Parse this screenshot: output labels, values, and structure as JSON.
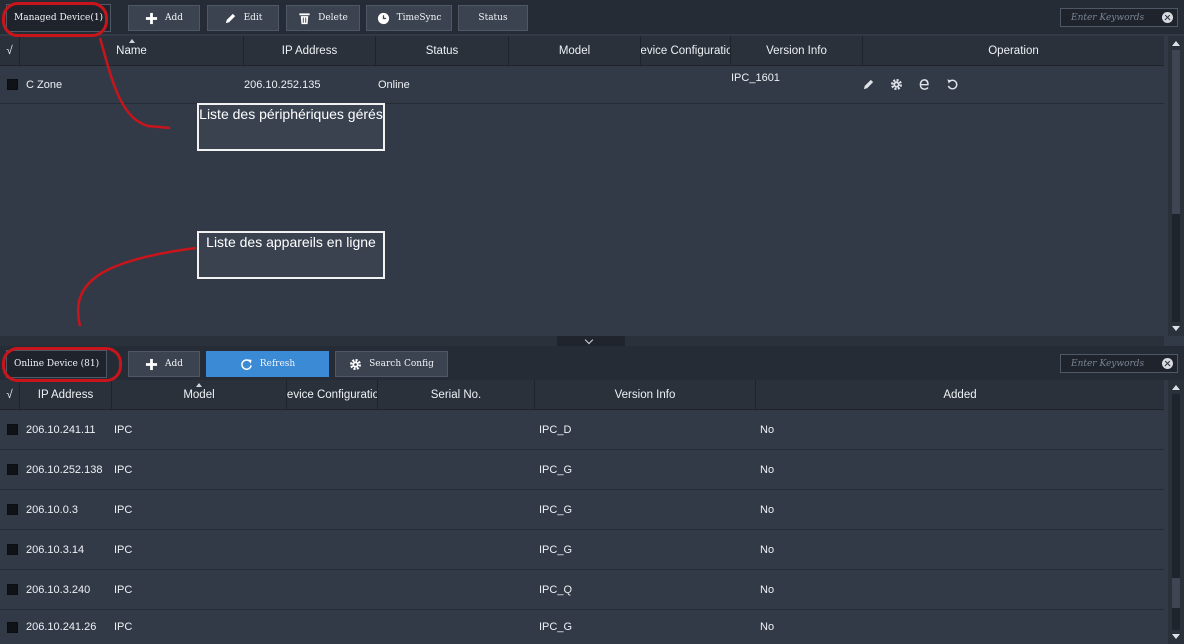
{
  "managed": {
    "tab_label": "Managed Device(1)",
    "buttons": {
      "add": "Add",
      "edit": "Edit",
      "delete": "Delete",
      "timesync": "TimeSync",
      "status": "Status"
    },
    "search_placeholder": "Enter Keywords",
    "columns": {
      "check": "√",
      "name": "Name",
      "ip": "IP Address",
      "status": "Status",
      "model": "Model",
      "config": "Device Configuration",
      "version": "Version Info",
      "operation": "Operation"
    },
    "rows": [
      {
        "name": "C Zone",
        "ip": "206.10.252.135",
        "status": "Online",
        "model": "",
        "config": "",
        "version": "IPC_1601"
      }
    ],
    "operation_icons": [
      "pencil-icon",
      "gear-icon",
      "browser-e-icon",
      "refresh-icon"
    ]
  },
  "online": {
    "tab_label": "Online Device (81)",
    "buttons": {
      "add": "Add",
      "refresh": "Refresh",
      "search_config": "Search Config"
    },
    "search_placeholder": "Enter Keywords",
    "columns": {
      "check": "√",
      "ip": "IP Address",
      "model": "Model",
      "config": "Device Configuration",
      "serial": "Serial No.",
      "version": "Version Info",
      "added": "Added"
    },
    "rows": [
      {
        "ip": "206.10.241.11",
        "model": "IPC",
        "config": "",
        "serial": "",
        "version": "IPC_D",
        "added": "No"
      },
      {
        "ip": "206.10.252.138",
        "model": "IPC",
        "config": "",
        "serial": "",
        "version": "IPC_G",
        "added": "No"
      },
      {
        "ip": "206.10.0.3",
        "model": "IPC",
        "config": "",
        "serial": "",
        "version": "IPC_G",
        "added": "No"
      },
      {
        "ip": "206.10.3.14",
        "model": "IPC",
        "config": "",
        "serial": "",
        "version": "IPC_G",
        "added": "No"
      },
      {
        "ip": "206.10.3.240",
        "model": "IPC",
        "config": "",
        "serial": "",
        "version": "IPC_Q",
        "added": "No"
      },
      {
        "ip": "206.10.241.26",
        "model": "IPC",
        "config": "",
        "serial": "",
        "version": "IPC_G",
        "added": "No"
      }
    ]
  },
  "annotations": {
    "managed_list": "Liste des périphériques gérés",
    "online_list": "Liste des appareils en ligne"
  },
  "colors": {
    "accent": "#3a8ad6",
    "annotation_red": "#c8151b",
    "background": "#323a47"
  }
}
